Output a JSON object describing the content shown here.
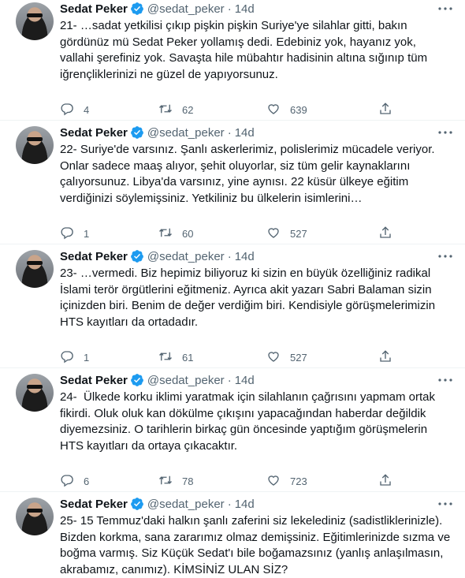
{
  "tweets": [
    {
      "name": "Sedat Peker",
      "handle": "@sedat_peker",
      "time": "14d",
      "text": "21- …sadat yetkilisi çıkıp pişkin pişkin Suriye'ye silahlar gitti, bakın gördünüz mü Sedat Peker yollamış dedi. Edebiniz yok, hayanız yok, vallahi şerefiniz yok. Savaşta hile mübahtır hadisinin altına sığınıp tüm iğrençliklerinizi ne güzel de yapıyorsunuz.",
      "replies": "4",
      "retweets": "62",
      "likes": "639"
    },
    {
      "name": "Sedat Peker",
      "handle": "@sedat_peker",
      "time": "14d",
      "text": "22- Suriye'de varsınız. Şanlı askerlerimiz, polislerimiz mücadele veriyor. Onlar sadece maaş alıyor, şehit oluyorlar, siz tüm gelir kaynaklarını çalıyorsunuz. Libya'da varsınız, yine aynısı. 22 küsür ülkeye eğitim verdiğinizi söylemişsiniz. Yetkiliniz bu ülkelerin isimlerini…",
      "replies": "1",
      "retweets": "60",
      "likes": "527"
    },
    {
      "name": "Sedat Peker",
      "handle": "@sedat_peker",
      "time": "14d",
      "text": "23- …vermedi. Biz hepimiz biliyoruz ki sizin en büyük özelliğiniz radikal İslami terör örgütlerini eğitmeniz. Ayrıca akit yazarı Sabri Balaman sizin içinizden biri. Benim de değer verdiğim biri. Kendisiyle görüşmelerimizin HTS kayıtları da ortadadır.",
      "replies": "1",
      "retweets": "61",
      "likes": "527"
    },
    {
      "name": "Sedat Peker",
      "handle": "@sedat_peker",
      "time": "14d",
      "text": "24-  Ülkede korku iklimi yaratmak için silahlanın çağrısını yapmam ortak fikirdi. Oluk oluk kan dökülme çıkışını yapacağından haberdar değildik diyemezsiniz. O tarihlerin birkaç gün öncesinde yaptığım görüşmelerin HTS kayıtları da ortaya çıkacaktır.",
      "replies": "6",
      "retweets": "78",
      "likes": "723"
    },
    {
      "name": "Sedat Peker",
      "handle": "@sedat_peker",
      "time": "14d",
      "text": "25- 15 Temmuz'daki halkın şanlı zaferini siz lekelediniz (sadistliklerinizle). Bizden korkma, sana zararımız olmaz demişsiniz. Eğitimlerinizde sızma ve boğma varmış. Siz Küçük Sedat'ı bile boğamazsınız (yanlış anlaşılmasın, akrabamız, canımız). KİMSİNİZ ULAN SİZ?",
      "replies": "",
      "retweets": "",
      "likes": ""
    }
  ],
  "icons": {
    "verified": "verified-badge-icon",
    "more": "more-dots-icon",
    "reply": "reply-icon",
    "retweet": "retweet-icon",
    "like": "heart-icon",
    "share": "share-icon"
  },
  "colors": {
    "verified": "#1d9bf0",
    "secondary_text": "#536471",
    "primary_text": "#0f1419"
  }
}
